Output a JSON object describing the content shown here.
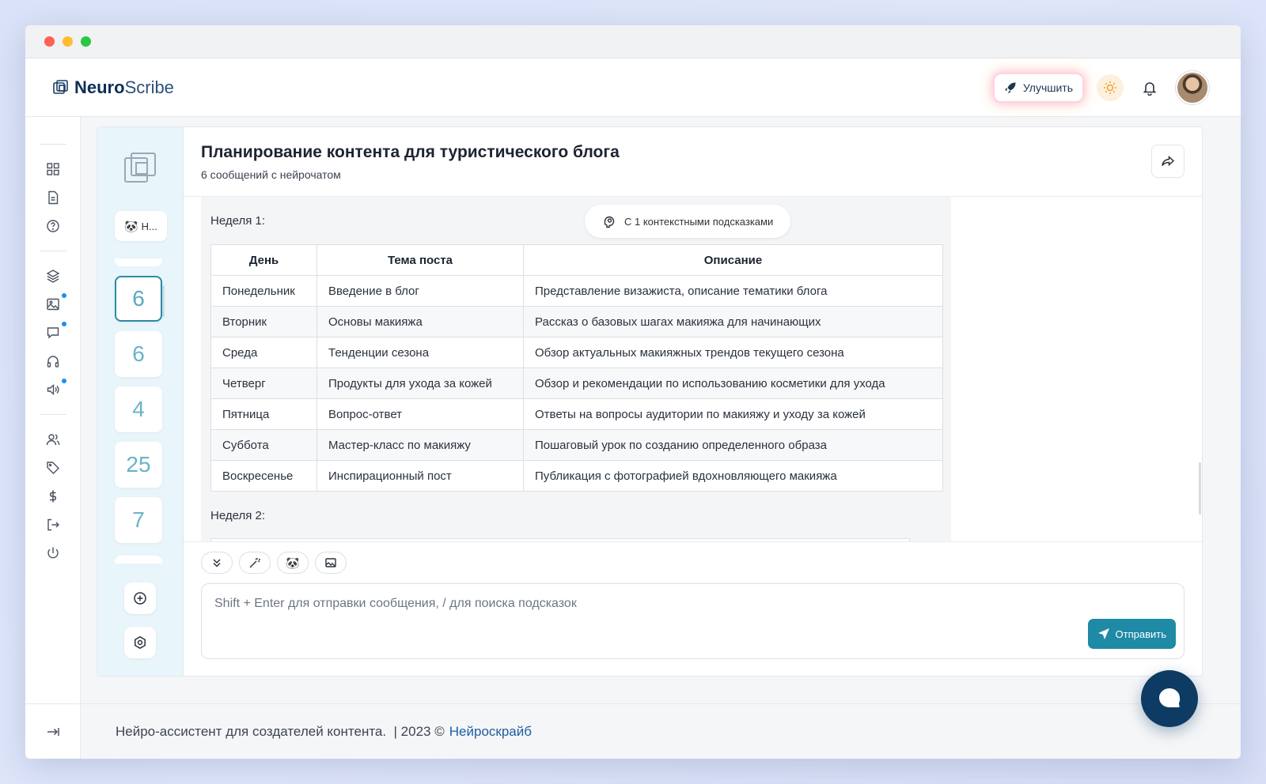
{
  "app": {
    "brand_bold": "Neuro",
    "brand_light": "Scribe"
  },
  "header": {
    "upgrade_label": "Улучшить"
  },
  "chat_list": {
    "persona_label": "Н...",
    "counts": [
      "6",
      "6",
      "4",
      "25",
      "7"
    ]
  },
  "chat": {
    "title": "Планирование контента для туристического блога",
    "subtitle": "6 сообщений с нейрочатом",
    "hint_pill": "С 1 контекстными подсказками",
    "week1_label": "Неделя 1:",
    "week2_label": "Неделя 2:",
    "table": {
      "headers": [
        "День",
        "Тема поста",
        "Описание"
      ],
      "rows": [
        [
          "Понедельник",
          "Введение в блог",
          "Представление визажиста, описание тематики блога"
        ],
        [
          "Вторник",
          "Основы макияжа",
          "Рассказ о базовых шагах макияжа для начинающих"
        ],
        [
          "Среда",
          "Тенденции сезона",
          "Обзор актуальных макияжных трендов текущего сезона"
        ],
        [
          "Четверг",
          "Продукты для ухода за кожей",
          "Обзор и рекомендации по использованию косметики для ухода"
        ],
        [
          "Пятница",
          "Вопрос-ответ",
          "Ответы на вопросы аудитории по макияжу и уходу за кожей"
        ],
        [
          "Суббота",
          "Мастер-класс по макияжу",
          "Пошаговый урок по созданию определенного образа"
        ],
        [
          "Воскресенье",
          "Инспирационный пост",
          "Публикация с фотографией вдохновляющего макияжа"
        ]
      ]
    }
  },
  "composer": {
    "placeholder": "Shift + Enter для отправки сообщения, / для поиска подсказок",
    "send_label": "Отправить"
  },
  "footer": {
    "text": "Нейро-ассистент для создателей контента.  | 2023 ©",
    "link": "Нейроскрайб"
  },
  "colors": {
    "accent": "#1f8aa5",
    "brand": "#0e2f55",
    "badge": "#1f8fe8"
  }
}
